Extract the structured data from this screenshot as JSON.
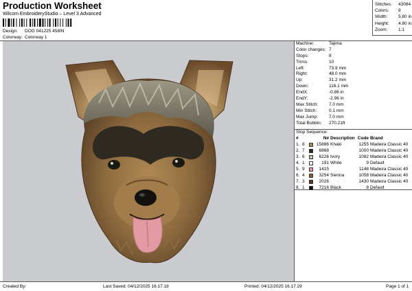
{
  "header": {
    "title": "Production Worksheet",
    "subtitle": "Wilcom EmbroideryStudio – Level 3 Advanced",
    "design_label": "Design:",
    "design_value": "DOG 041225 458IN",
    "colorway_label": "Colorway:",
    "colorway_value": "Colorway 1"
  },
  "stats": {
    "stitches_label": "Stitches:",
    "stitches": "43084",
    "colors_label": "Colors:",
    "colors": "8",
    "width_label": "Width:",
    "width": "5.80 in",
    "height_label": "Height:",
    "height": "4.80 in",
    "zoom_label": "Zoom:",
    "zoom": "1:1"
  },
  "machine_info": [
    {
      "label": "Machine:",
      "value": "Tajima"
    },
    {
      "label": "Color changes:",
      "value": "7"
    },
    {
      "label": "Stops:",
      "value": "8"
    },
    {
      "label": "Trims:",
      "value": "10"
    },
    {
      "label": "Left:",
      "value": "73.9 mm"
    },
    {
      "label": "Right:",
      "value": "48.0 mm"
    },
    {
      "label": "Up:",
      "value": "31.2 mm"
    },
    {
      "label": "Down:",
      "value": "116.1 mm"
    },
    {
      "label": "EndX:",
      "value": "-0.86 in"
    },
    {
      "label": "EndY:",
      "value": "-2.96 in"
    },
    {
      "label": "Max Stitch:",
      "value": "7.0 mm"
    },
    {
      "label": "Min Stitch:",
      "value": "0.1 mm"
    },
    {
      "label": "Max Jump:",
      "value": "7.0 mm"
    },
    {
      "label": "Total Bobbin:",
      "value": "270.21ft"
    }
  ],
  "stop_sequence": {
    "title": "Stop Sequence:",
    "headers": {
      "num": "#",
      "stitches": "N#",
      "description": "Description",
      "code": "Code",
      "brand": "Brand"
    },
    "rows": [
      {
        "num": "1.",
        "stop": "8",
        "color": "#a88a5a",
        "stitches": "15886",
        "description": "Khaki",
        "code": "1255",
        "brand": "Madeira Classic 40"
      },
      {
        "num": "2.",
        "stop": "7",
        "color": "#2b2b2b",
        "stitches": "6868",
        "description": "",
        "code": "1000",
        "brand": "Madeira Classic 40"
      },
      {
        "num": "3.",
        "stop": "6",
        "color": "#c8c3a8",
        "stitches": "6226",
        "description": "Ivory",
        "code": "1082",
        "brand": "Madeira Classic 40"
      },
      {
        "num": "4.",
        "stop": "1",
        "color": "#ffffff",
        "stitches": "191",
        "description": "White",
        "code": "9",
        "brand": "Default"
      },
      {
        "num": "5.",
        "stop": "9",
        "color": "#e39aa3",
        "stitches": "1415",
        "description": "",
        "code": "1148",
        "brand": "Madeira Classic 40"
      },
      {
        "num": "6.",
        "stop": "4",
        "color": "#8a5a2e",
        "stitches": "3254",
        "description": "Sienna",
        "code": "1058",
        "brand": "Madeira Classic 40"
      },
      {
        "num": "7.",
        "stop": "3",
        "color": "#5a3a22",
        "stitches": "2026",
        "description": "",
        "code": "1430",
        "brand": "Madeira Classic 40"
      },
      {
        "num": "8.",
        "stop": "1",
        "color": "#111111",
        "stitches": "7216",
        "description": "Black",
        "code": "8",
        "brand": "Default"
      }
    ]
  },
  "footer": {
    "created_by": "Created By:",
    "last_saved": "Last Saved: 04/12/2025 16.17.18",
    "printed": "Printed: 04/12/2025 16.17.29",
    "page": "Page 1 of 1"
  }
}
